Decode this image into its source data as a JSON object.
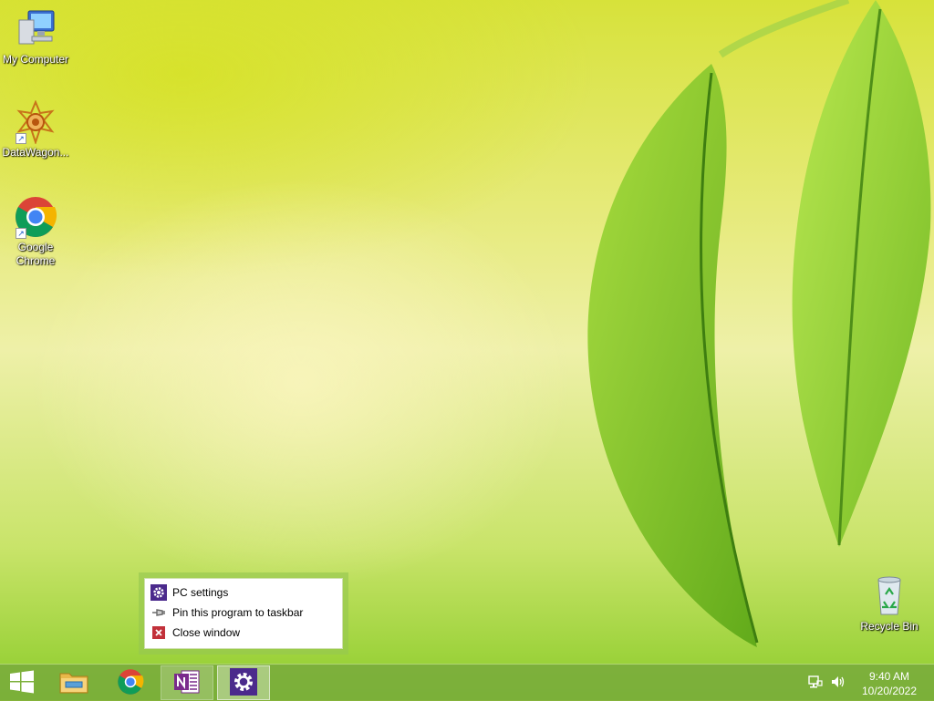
{
  "desktop": {
    "icons": [
      {
        "label": "My Computer",
        "icon": "computer-icon"
      },
      {
        "label": "DataWagon...",
        "icon": "datawagon-icon"
      },
      {
        "label": "Google Chrome",
        "icon": "chrome-icon"
      },
      {
        "label": "Recycle Bin",
        "icon": "recycle-bin-icon"
      }
    ]
  },
  "jump_list": {
    "items": [
      {
        "label": "PC settings",
        "icon": "gear-icon"
      },
      {
        "label": "Pin this program to taskbar",
        "icon": "pin-icon"
      },
      {
        "label": "Close window",
        "icon": "close-icon"
      }
    ]
  },
  "taskbar": {
    "buttons": [
      {
        "name": "start",
        "icon": "windows-logo-icon"
      },
      {
        "name": "file-explorer",
        "icon": "folder-icon"
      },
      {
        "name": "google-chrome",
        "icon": "chrome-icon"
      },
      {
        "name": "onenote",
        "icon": "onenote-icon",
        "state": "open"
      },
      {
        "name": "pc-settings",
        "icon": "gear-icon",
        "state": "active"
      }
    ],
    "tray": {
      "icons": [
        "network-icon",
        "volume-icon"
      ],
      "time": "9:40 AM",
      "date": "10/20/2022"
    }
  },
  "colors": {
    "taskbar": "#78aa3c",
    "settings_purple": "#4b2a8c",
    "onenote_purple": "#7a2a8c"
  }
}
